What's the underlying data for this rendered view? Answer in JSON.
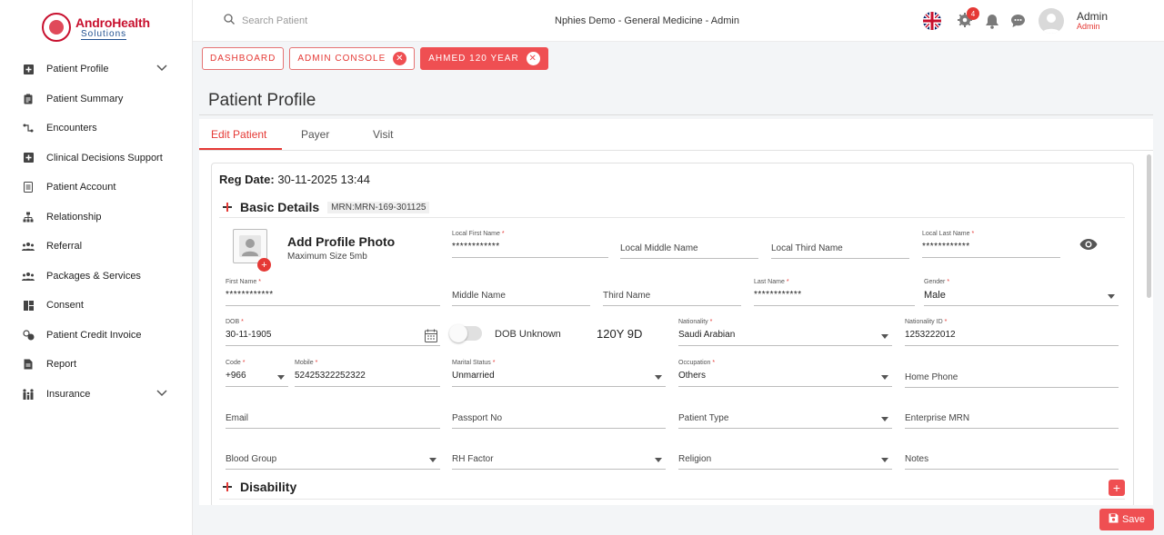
{
  "brand": {
    "name": "AndroHealth",
    "tagline": "Solutions"
  },
  "sidebar": {
    "items": [
      {
        "label": "Patient Profile",
        "icon": "plus-box-icon",
        "expandable": true
      },
      {
        "label": "Patient Summary",
        "icon": "clipboard-icon"
      },
      {
        "label": "Encounters",
        "icon": "route-icon"
      },
      {
        "label": "Clinical Decisions Support",
        "icon": "plus-box-icon"
      },
      {
        "label": "Patient Account",
        "icon": "document-icon"
      },
      {
        "label": "Relationship",
        "icon": "tree-icon"
      },
      {
        "label": "Referral",
        "icon": "group-icon"
      },
      {
        "label": "Packages & Services",
        "icon": "group-icon"
      },
      {
        "label": "Consent",
        "icon": "grid-icon"
      },
      {
        "label": "Patient Credit Invoice",
        "icon": "credit-icon"
      },
      {
        "label": "Report",
        "icon": "report-icon"
      },
      {
        "label": "Insurance",
        "icon": "family-icon",
        "expandable": true
      }
    ]
  },
  "topbar": {
    "search_placeholder": "Search Patient",
    "context": "Nphies Demo - General Medicine - Admin",
    "notification_count": "4",
    "user_name": "Admin",
    "user_role": "Admin"
  },
  "breadcrumbs": [
    {
      "label": "DASHBOARD",
      "closable": false,
      "active": false
    },
    {
      "label": "ADMIN CONSOLE",
      "closable": true,
      "active": false
    },
    {
      "label": "AHMED 120 YEAR",
      "closable": true,
      "active": true
    }
  ],
  "page": {
    "title": "Patient Profile"
  },
  "tabs": [
    "Edit Patient",
    "Payer",
    "Visit"
  ],
  "form": {
    "reg_label": "Reg Date:",
    "reg_value": "30-11-2025 13:44",
    "basic_details": "Basic Details",
    "mrn": "MRN:MRN-169-301125",
    "add_photo": "Add Profile Photo",
    "max_size": "Maximum Size 5mb",
    "local_first_name": {
      "label": "Local First Name",
      "value": "************"
    },
    "local_middle_name": {
      "placeholder": "Local Middle Name"
    },
    "local_third_name": {
      "placeholder": "Local Third Name"
    },
    "local_last_name": {
      "label": "Local Last Name",
      "value": "************"
    },
    "first_name": {
      "label": "First Name",
      "value": "************"
    },
    "middle_name": {
      "placeholder": "Middle Name"
    },
    "third_name": {
      "placeholder": "Third Name"
    },
    "last_name": {
      "label": "Last Name",
      "value": "************"
    },
    "gender": {
      "label": "Gender",
      "value": "Male"
    },
    "dob": {
      "label": "DOB",
      "value": "30-11-1905"
    },
    "dob_unknown": "DOB Unknown",
    "age": "120Y 9D",
    "nationality": {
      "label": "Nationality",
      "value": "Saudi Arabian"
    },
    "nationality_id": {
      "label": "Nationality ID",
      "value": "1253222012"
    },
    "code": {
      "label": "Code",
      "value": "+966"
    },
    "mobile": {
      "label": "Mobile",
      "value": "52425322252322"
    },
    "marital_status": {
      "label": "Marital Status",
      "value": "Unmarried"
    },
    "occupation": {
      "label": "Occupation",
      "value": "Others"
    },
    "home_phone": {
      "placeholder": "Home Phone"
    },
    "email": {
      "placeholder": "Email"
    },
    "passport_no": {
      "placeholder": "Passport No"
    },
    "patient_type": {
      "placeholder": "Patient Type"
    },
    "enterprise_mrn": {
      "placeholder": "Enterprise MRN"
    },
    "blood_group": {
      "placeholder": "Blood Group"
    },
    "rh_factor": {
      "placeholder": "RH Factor"
    },
    "religion": {
      "placeholder": "Religion"
    },
    "notes": {
      "placeholder": "Notes"
    },
    "disability": "Disability",
    "required_mark": "*"
  },
  "actions": {
    "save": "Save"
  },
  "colors": {
    "accent": "#ef4f52",
    "brand_red": "#c8102e",
    "brand_blue": "#1f4f8f"
  }
}
